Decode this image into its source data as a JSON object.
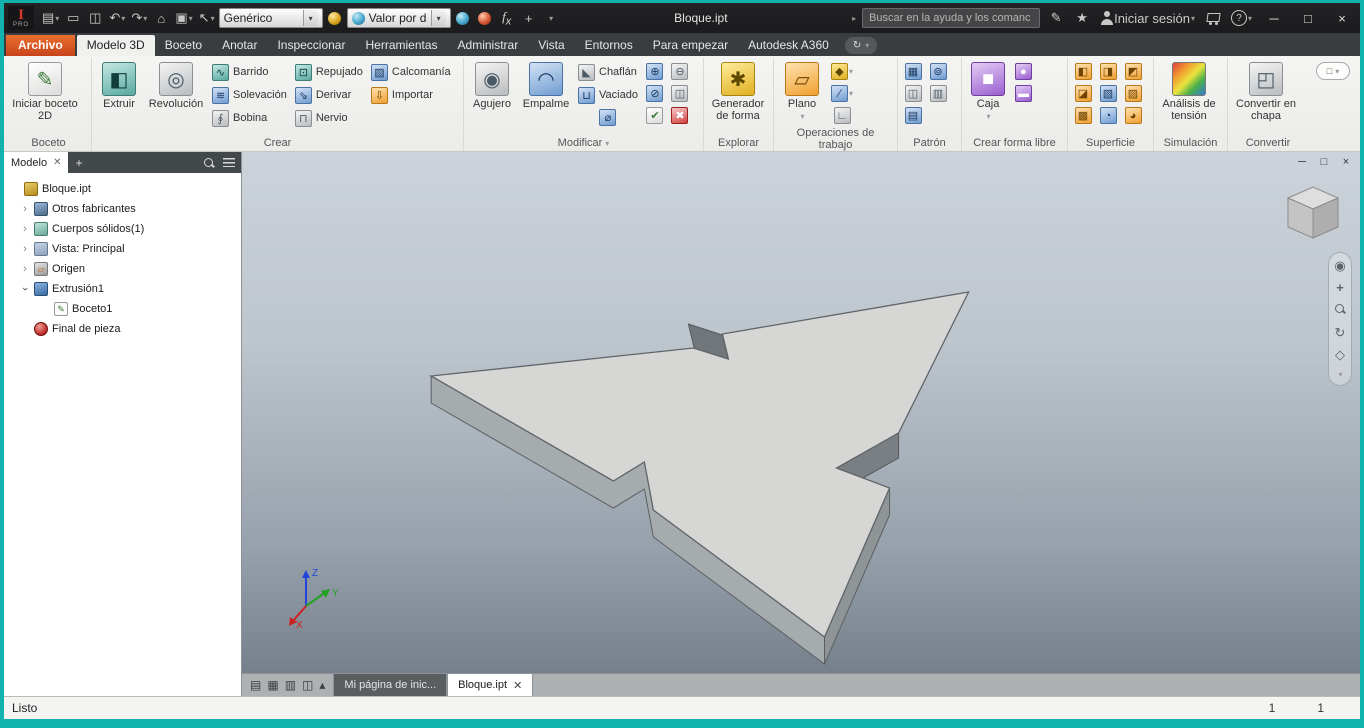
{
  "window": {
    "border_color": "#12b3ae"
  },
  "titlebar": {
    "title": "Bloque.ipt",
    "material_value": "Genérico",
    "appearance_value": "Valor por d",
    "search_placeholder": "Buscar en la ayuda y los comanc",
    "signin_label": "Iniciar sesión"
  },
  "ribbon": {
    "tabs": [
      {
        "label": "Archivo"
      },
      {
        "label": "Modelo 3D"
      },
      {
        "label": "Boceto"
      },
      {
        "label": "Anotar"
      },
      {
        "label": "Inspeccionar"
      },
      {
        "label": "Herramientas"
      },
      {
        "label": "Administrar"
      },
      {
        "label": "Vista"
      },
      {
        "label": "Entornos"
      },
      {
        "label": "Para empezar"
      },
      {
        "label": "Autodesk A360"
      }
    ],
    "groups": {
      "boceto": {
        "label": "Boceto",
        "iniciar": "Iniciar boceto 2D"
      },
      "crear": {
        "label": "Crear",
        "extruir": "Extruir",
        "revolucion": "Revolución",
        "barrido": "Barrido",
        "solevacion": "Solevación",
        "bobina": "Bobina",
        "repujado": "Repujado",
        "derivar": "Derivar",
        "nervio": "Nervio",
        "calcomania": "Calcomanía",
        "importar": "Importar"
      },
      "modificar": {
        "label": "Modificar",
        "agujero": "Agujero",
        "empalme": "Empalme",
        "chaflan": "Chaflán",
        "vaciado": "Vaciado"
      },
      "explorar": {
        "label": "Explorar",
        "generador": "Generador de forma"
      },
      "operaciones": {
        "label": "Operaciones de trabajo",
        "plano": "Plano"
      },
      "patron": {
        "label": "Patrón"
      },
      "forma_libre": {
        "label": "Crear forma libre",
        "caja": "Caja"
      },
      "superficie": {
        "label": "Superficie"
      },
      "simulacion": {
        "label": "Simulación",
        "analisis": "Análisis de tensión"
      },
      "convertir": {
        "label": "Convertir",
        "chapa": "Convertir en chapa"
      }
    }
  },
  "browser": {
    "panel_tab": "Modelo",
    "items": [
      {
        "label": "Bloque.ipt"
      },
      {
        "label": "Otros fabricantes"
      },
      {
        "label": "Cuerpos sólidos(1)"
      },
      {
        "label": "Vista: Principal"
      },
      {
        "label": "Origen"
      },
      {
        "label": "Extrusión1"
      },
      {
        "label": "Boceto1"
      },
      {
        "label": "Final de pieza"
      }
    ]
  },
  "viewport": {
    "axis_x": "X",
    "axis_y": "Y",
    "axis_z": "Z"
  },
  "docbar": {
    "home_tab": "Mi página de inic...",
    "active_tab": "Bloque.ipt"
  },
  "statusbar": {
    "text": "Listo",
    "num1": "1",
    "num2": "1"
  }
}
